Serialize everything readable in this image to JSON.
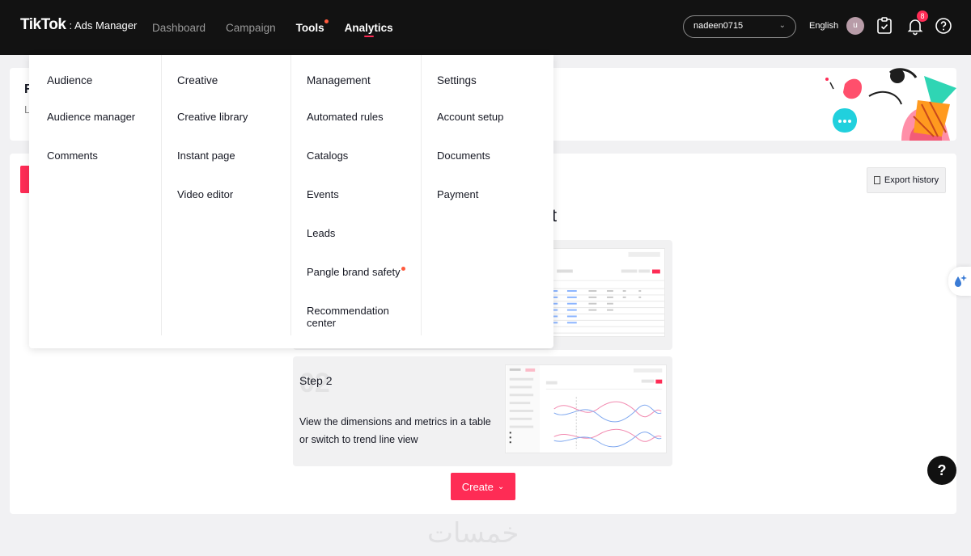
{
  "brand": {
    "logo": "TikTok",
    "product": ": Ads Manager"
  },
  "nav": [
    {
      "label": "Dashboard",
      "strong": false
    },
    {
      "label": "Campaign",
      "strong": false
    },
    {
      "label": "Tools",
      "strong": true,
      "dot": true
    },
    {
      "label": "Analytics",
      "strong": true,
      "active": true
    }
  ],
  "account": {
    "value": "nadeen0715"
  },
  "language": "English",
  "user": {
    "initial": "u"
  },
  "notifications": {
    "count": "8"
  },
  "menu": {
    "columns": [
      {
        "heading": "Audience",
        "items": [
          {
            "label": "Audience manager"
          },
          {
            "label": "Comments"
          }
        ]
      },
      {
        "heading": "Creative",
        "items": [
          {
            "label": "Creative library"
          },
          {
            "label": "Instant page"
          },
          {
            "label": "Video editor"
          }
        ]
      },
      {
        "heading": "Management",
        "items": [
          {
            "label": "Automated rules"
          },
          {
            "label": "Catalogs"
          },
          {
            "label": "Events"
          },
          {
            "label": "Leads"
          },
          {
            "label": "Pangle brand safety",
            "dot": true
          },
          {
            "label": "Recommendation center"
          }
        ]
      },
      {
        "heading": "Settings",
        "items": [
          {
            "label": "Account setup"
          },
          {
            "label": "Documents"
          },
          {
            "label": "Payment"
          }
        ]
      }
    ]
  },
  "page": {
    "partial_header": "R",
    "partial_sub": "L",
    "partial_title_end": "t",
    "export_label": "Export history",
    "step2": {
      "number": "02",
      "title": "Step 2",
      "description": "View the dimensions and metrics in a table or switch to trend line view"
    },
    "create_label": "Create",
    "help_label": "?"
  },
  "watermark": "خمسات",
  "colors": {
    "accent": "#fe2c55",
    "topbar": "#121212",
    "dot": "#ff5a3d"
  }
}
